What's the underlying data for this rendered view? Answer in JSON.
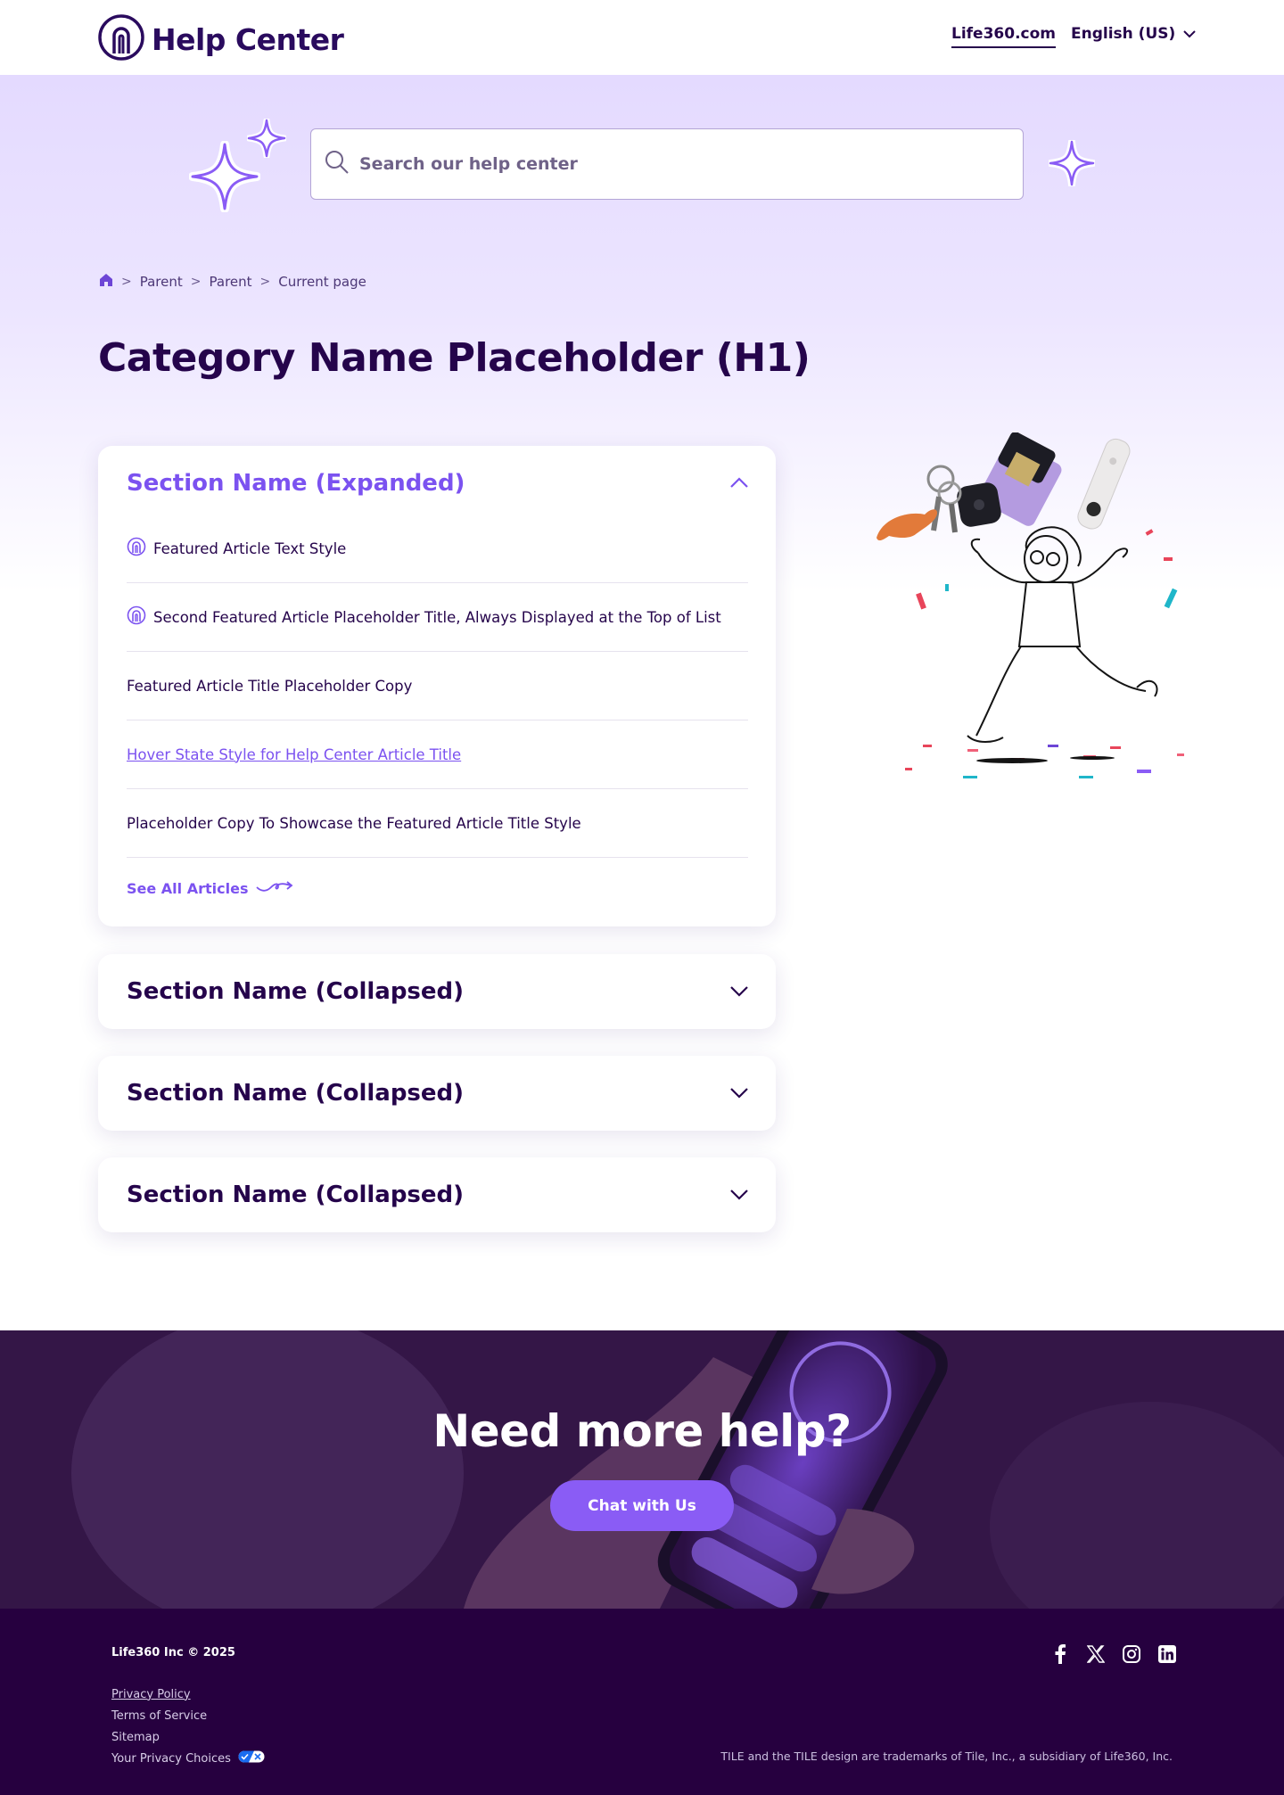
{
  "header": {
    "logo_text": "Help Center",
    "nav_link": "Life360.com",
    "language": "English (US)"
  },
  "search": {
    "placeholder": "Search our help center"
  },
  "breadcrumb": {
    "items": [
      "Parent",
      "Parent",
      "Current page"
    ]
  },
  "page_title": "Category Name Placeholder (H1)",
  "sections": {
    "expanded": {
      "title": "Section Name (Expanded)",
      "articles": [
        {
          "title": "Featured Article Text Style",
          "featured": true
        },
        {
          "title": "Second Featured Article Placeholder Title, Always Displayed at the Top of List",
          "featured": true
        },
        {
          "title": "Featured Article Title Placeholder Copy",
          "featured": false
        },
        {
          "title": "Hover State Style for Help Center Article Title",
          "featured": false,
          "hover": true
        },
        {
          "title": "Placeholder Copy To Showcase the Featured Article Title Style",
          "featured": false
        }
      ],
      "see_all": "See All Articles"
    },
    "collapsed": [
      {
        "title": "Section Name (Collapsed)"
      },
      {
        "title": "Section Name (Collapsed)"
      },
      {
        "title": "Section Name (Collapsed)"
      }
    ]
  },
  "cta": {
    "title": "Need more help?",
    "button": "Chat with Us"
  },
  "footer": {
    "copyright": "Life360 Inc © 2025",
    "links": [
      "Privacy Policy",
      "Terms of Service",
      "Sitemap",
      "Your Privacy Choices"
    ],
    "social_icons": [
      "facebook-icon",
      "x-icon",
      "instagram-icon",
      "linkedin-icon"
    ],
    "trademark": "TILE and the TILE design are trademarks of Tile, Inc., a subsidiary of Life360, Inc."
  },
  "colors": {
    "brand_dark": "#25044b",
    "accent": "#7b52f0",
    "footer_bg": "#26003f",
    "hero_bg": "#e4daff"
  }
}
